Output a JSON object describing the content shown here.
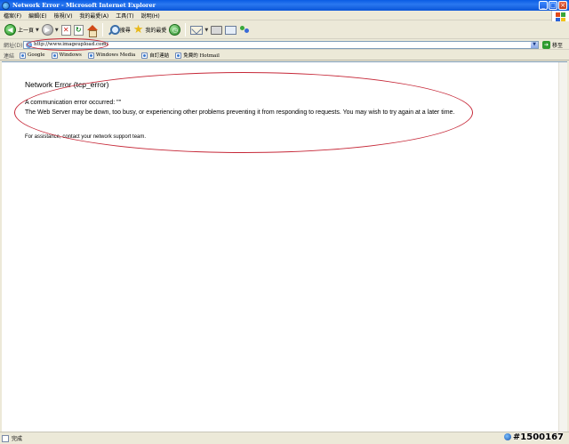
{
  "window": {
    "title": "Network Error - Microsoft Internet Explorer",
    "minimize": "_",
    "maximize": "□",
    "close": "×"
  },
  "menu": [
    "檔案(F)",
    "編輯(E)",
    "檢視(V)",
    "我的最愛(A)",
    "工具(T)",
    "說明(H)"
  ],
  "toolbar": {
    "back_label": "上一頁",
    "search_label": "搜尋",
    "favorites_label": "我的最愛"
  },
  "address": {
    "label": "網址(D)",
    "url": "http://www.imageupload.com/",
    "go_label": "移至"
  },
  "links": {
    "label": "連結",
    "items": [
      "Google",
      "Windows",
      "Windows Media",
      "自訂連結",
      "免費的 Hotmail"
    ]
  },
  "error": {
    "title": "Network Error (tcp_error)",
    "line1": "A communication error occurred: \"\"",
    "line2": "The Web Server may be down, too busy, or experiencing other problems preventing it from responding to requests. You may wish to try again at a later time.",
    "assist": "For assistance, contact your network support team."
  },
  "status": {
    "text": "完成",
    "watermark": "#1500167"
  },
  "colors": {
    "annotation": "#c62838",
    "titlebar": "#0a5ce4"
  }
}
